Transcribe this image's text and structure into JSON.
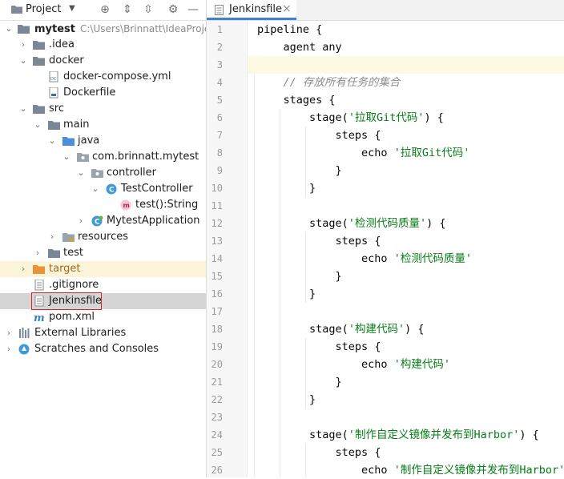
{
  "project_panel": {
    "title": "Project",
    "toolbar_icons": [
      "locate-icon",
      "expand-all-icon",
      "collapse-all-icon",
      "settings-icon",
      "hide-icon"
    ],
    "tree": [
      {
        "label": "mytest",
        "path": "C:\\Users\\Brinnatt\\IdeaProjec",
        "icon": "folder"
      },
      {
        "label": ".idea",
        "icon": "folder"
      },
      {
        "label": "docker",
        "icon": "folder"
      },
      {
        "label": "docker-compose.yml",
        "icon": "docker-compose-file"
      },
      {
        "label": "Dockerfile",
        "icon": "text-file"
      },
      {
        "label": "src",
        "icon": "folder"
      },
      {
        "label": "main",
        "icon": "folder"
      },
      {
        "label": "java",
        "icon": "source-folder"
      },
      {
        "label": "com.brinnatt.mytest",
        "icon": "package"
      },
      {
        "label": "controller",
        "icon": "package"
      },
      {
        "label": "TestController",
        "icon": "class"
      },
      {
        "label": "test():String",
        "icon": "method"
      },
      {
        "label": "MytestApplication",
        "icon": "spring-class"
      },
      {
        "label": "resources",
        "icon": "resources-folder"
      },
      {
        "label": "test",
        "icon": "folder"
      },
      {
        "label": "target",
        "icon": "excluded-folder"
      },
      {
        "label": ".gitignore",
        "icon": "text-file"
      },
      {
        "label": "Jenkinsfile",
        "icon": "text-file"
      },
      {
        "label": "pom.xml",
        "icon": "maven-file"
      },
      {
        "label": "External Libraries",
        "icon": "libraries"
      },
      {
        "label": "Scratches and Consoles",
        "icon": "scratches"
      }
    ]
  },
  "editor": {
    "tab": {
      "label": "Jenkinsfile",
      "close": "×"
    },
    "line_numbers": [
      "1",
      "2",
      "3",
      "4",
      "5",
      "6",
      "7",
      "8",
      "9",
      "10",
      "11",
      "12",
      "13",
      "14",
      "15",
      "16",
      "17",
      "18",
      "19",
      "20",
      "21",
      "22",
      "23",
      "24",
      "25",
      "26"
    ],
    "lines": [
      {
        "indent": "",
        "code": "pipeline {"
      },
      {
        "indent": "    ",
        "code": "agent any"
      },
      {
        "indent": "",
        "code": ""
      },
      {
        "indent": "    ",
        "comment": "// 存放所有任务的集合"
      },
      {
        "indent": "    ",
        "code": "stages {"
      },
      {
        "indent": "        ",
        "code": "stage(",
        "str": "'拉取Git代码'",
        "tail": ") {"
      },
      {
        "indent": "            ",
        "code": "steps {"
      },
      {
        "indent": "                ",
        "code": "echo ",
        "str": "'拉取Git代码'"
      },
      {
        "indent": "            ",
        "code": "}"
      },
      {
        "indent": "        ",
        "code": "}"
      },
      {
        "indent": "",
        "code": ""
      },
      {
        "indent": "        ",
        "code": "stage(",
        "str": "'检测代码质量'",
        "tail": ") {"
      },
      {
        "indent": "            ",
        "code": "steps {"
      },
      {
        "indent": "                ",
        "code": "echo ",
        "str": "'检测代码质量'"
      },
      {
        "indent": "            ",
        "code": "}"
      },
      {
        "indent": "        ",
        "code": "}"
      },
      {
        "indent": "",
        "code": ""
      },
      {
        "indent": "        ",
        "code": "stage(",
        "str": "'构建代码'",
        "tail": ") {"
      },
      {
        "indent": "            ",
        "code": "steps {"
      },
      {
        "indent": "                ",
        "code": "echo ",
        "str": "'构建代码'"
      },
      {
        "indent": "            ",
        "code": "}"
      },
      {
        "indent": "        ",
        "code": "}"
      },
      {
        "indent": "",
        "code": ""
      },
      {
        "indent": "        ",
        "code": "stage(",
        "str": "'制作自定义镜像并发布到Harbor'",
        "tail": ") {"
      },
      {
        "indent": "            ",
        "code": "steps {"
      },
      {
        "indent": "                ",
        "code": "echo ",
        "str": "'制作自定义镜像并发布到Harbor'"
      }
    ]
  },
  "colors": {
    "selection": "#d5d5d5",
    "highlight_box": "#e02020",
    "string": "#067d17",
    "comment": "#8c8c8c",
    "tab_underline": "#4083c9"
  }
}
